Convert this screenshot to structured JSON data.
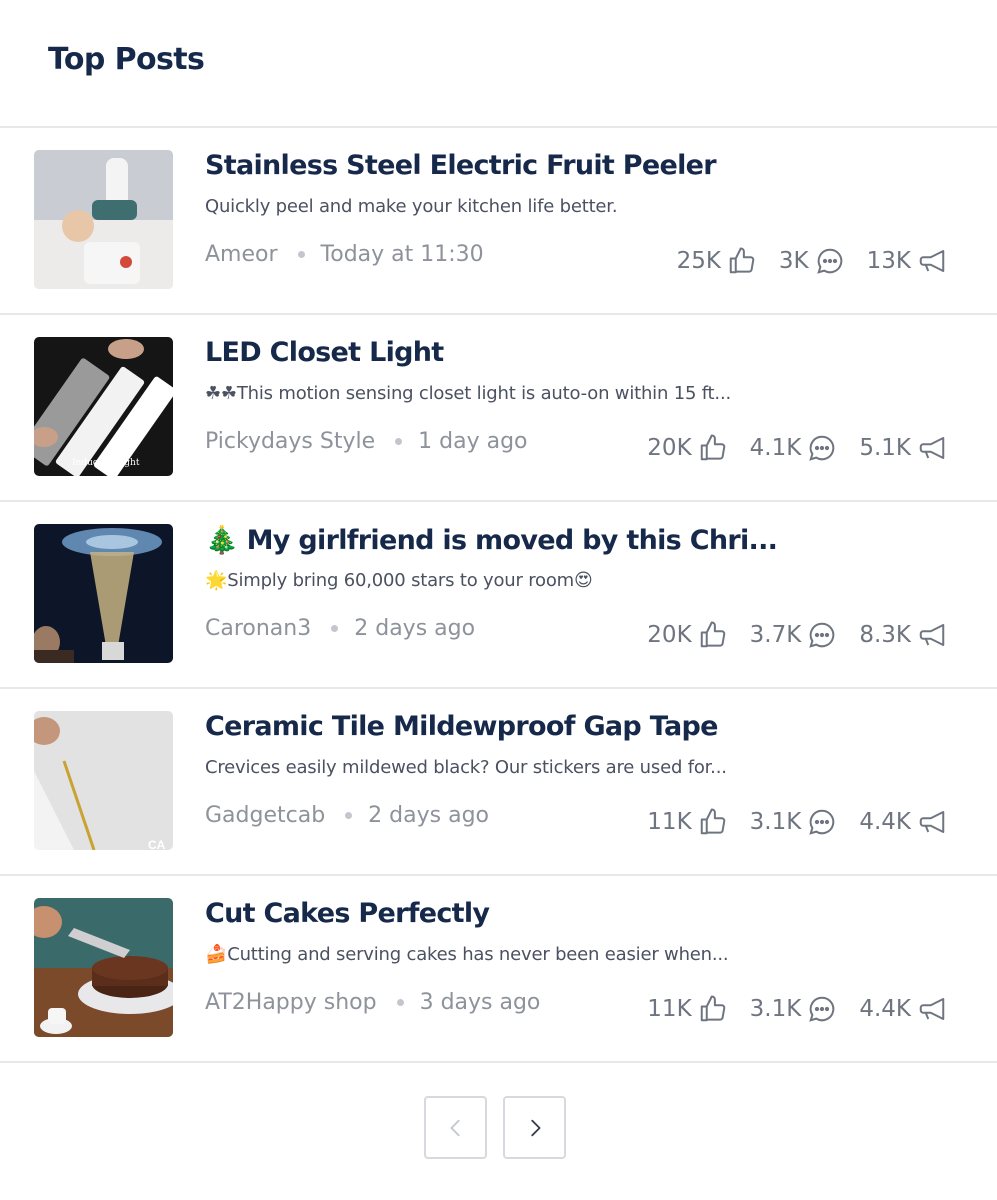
{
  "header": {
    "title": "Top Posts"
  },
  "posts": [
    {
      "title": "Stainless Steel Electric Fruit Peeler",
      "description": "Quickly peel and make your kitchen life better.",
      "author": "Ameor",
      "time": "Today at 11:30",
      "likes": "25K",
      "comments": "3K",
      "shares": "13K",
      "thumbnail": "fruit-peeler-photo"
    },
    {
      "title": "LED Closet Light",
      "description_emoji": "☘☘",
      "description": "This motion sensing closet light is auto-on within 15 ft...",
      "author": "Pickydays Style",
      "time": "1 day ago",
      "likes": "20K",
      "comments": "4.1K",
      "shares": "5.1K",
      "thumbnail": "closet-light-photo",
      "thumbnail_caption": "Induction light"
    },
    {
      "title_emoji": "🎄",
      "title": "My girlfriend is moved by this Chri...",
      "description_emoji": "🌟",
      "description": "Simply bring 60,000 stars to your room",
      "description_suffix_emoji": "😍",
      "author": "Caronan3",
      "time": "2 days ago",
      "likes": "20K",
      "comments": "3.7K",
      "shares": "8.3K",
      "thumbnail": "star-projector-photo"
    },
    {
      "title": "Ceramic Tile Mildewproof Gap Tape",
      "description": "Crevices easily mildewed black? Our stickers are used for...",
      "author": "Gadgetcab",
      "time": "2 days ago",
      "likes": "11K",
      "comments": "3.1K",
      "shares": "4.4K",
      "thumbnail": "gap-tape-photo",
      "thumbnail_caption": "CA"
    },
    {
      "title": "Cut Cakes Perfectly",
      "description_emoji": "🍰",
      "description": "Cutting and serving cakes has never been easier when...",
      "author": "AT2Happy shop",
      "time": "3 days ago",
      "likes": "11K",
      "comments": "3.1K",
      "shares": "4.4K",
      "thumbnail": "cake-cutter-photo"
    }
  ],
  "icons": {
    "like": "thumbs-up-icon",
    "comment": "comment-bubble-icon",
    "share": "megaphone-icon",
    "prev": "chevron-left-icon",
    "next": "chevron-right-icon"
  },
  "colors": {
    "title": "#16294a",
    "meta": "#8d929b",
    "divider": "#e6e8ec",
    "icon": "#6f7580"
  }
}
